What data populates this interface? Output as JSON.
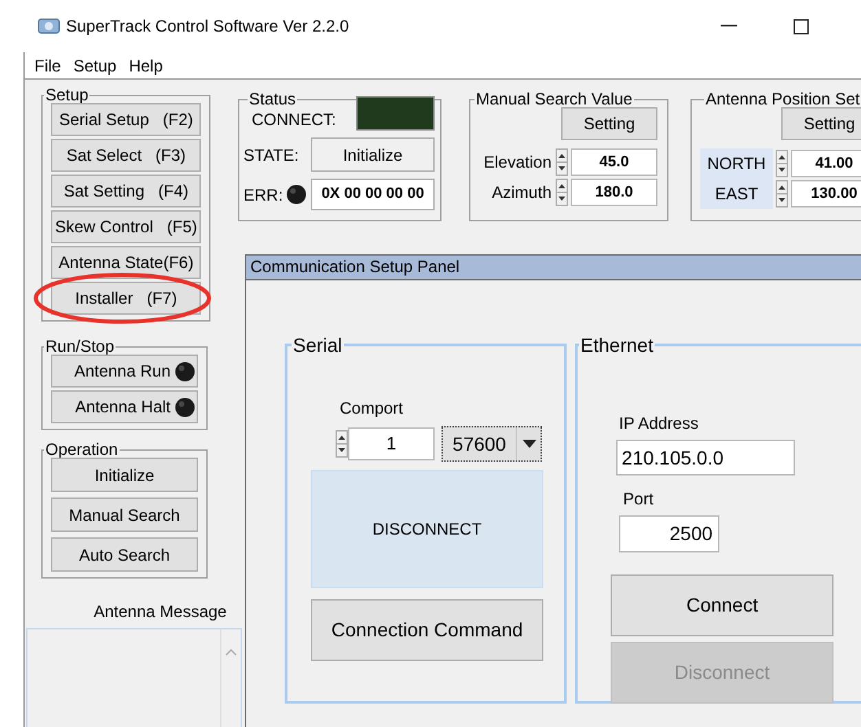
{
  "window": {
    "title": "SuperTrack Control Software Ver 2.2.0"
  },
  "menu": [
    "File",
    "Setup",
    "Help"
  ],
  "setup": {
    "title": "Setup",
    "buttons": [
      {
        "label": "Serial Setup",
        "key": "(F2)",
        "highlighted": false
      },
      {
        "label": "Sat Select",
        "key": "(F3)",
        "highlighted": false
      },
      {
        "label": "Sat Setting",
        "key": "(F4)",
        "highlighted": false
      },
      {
        "label": "Skew Control",
        "key": "(F5)",
        "highlighted": false
      },
      {
        "label": "Antenna State(F6)",
        "highlighted": false
      },
      {
        "label": "Installer",
        "key": "(F7)",
        "highlighted": true
      }
    ]
  },
  "run_stop": {
    "title": "Run/Stop",
    "buttons": [
      {
        "label": "Antenna Run",
        "lit": false
      },
      {
        "label": "Antenna Halt",
        "lit": false
      }
    ]
  },
  "operation": {
    "title": "Operation",
    "buttons": [
      "Initialize",
      "Manual Search",
      "Auto Search"
    ]
  },
  "antenna_message": {
    "label": "Antenna Message"
  },
  "status": {
    "title": "Status",
    "connect_label": "CONNECT:",
    "connected": false,
    "state_label": "STATE:",
    "state": "Initialize",
    "err_label": "ERR:",
    "error": false,
    "err_code": "0X 00 00 00 00"
  },
  "manual_search": {
    "title": "Manual Search Value",
    "button": "Setting",
    "fields": [
      {
        "label": "Elevation",
        "value": "45.0"
      },
      {
        "label": "Azimuth",
        "value": "180.0"
      }
    ]
  },
  "antenna_position": {
    "title": "Antenna Position Set",
    "button": "Setting",
    "fields": [
      {
        "label": "NORTH",
        "value": "41.00"
      },
      {
        "label": "EAST",
        "value": "130.00"
      }
    ]
  },
  "panel": {
    "title": "Communication Setup Panel",
    "serial": {
      "title": "Serial",
      "comport_label": "Comport",
      "comport": "1",
      "baud": "57600",
      "status": "DISCONNECT",
      "command_button": "Connection Command"
    },
    "ethernet": {
      "title": "Ethernet",
      "ip_label": "IP Address",
      "ip": "210.105.0.0",
      "port_label": "Port",
      "port": "2500",
      "buttons": [
        {
          "label": "Connect",
          "disabled": false
        },
        {
          "label": "Disconnect",
          "disabled": true
        }
      ]
    }
  }
}
